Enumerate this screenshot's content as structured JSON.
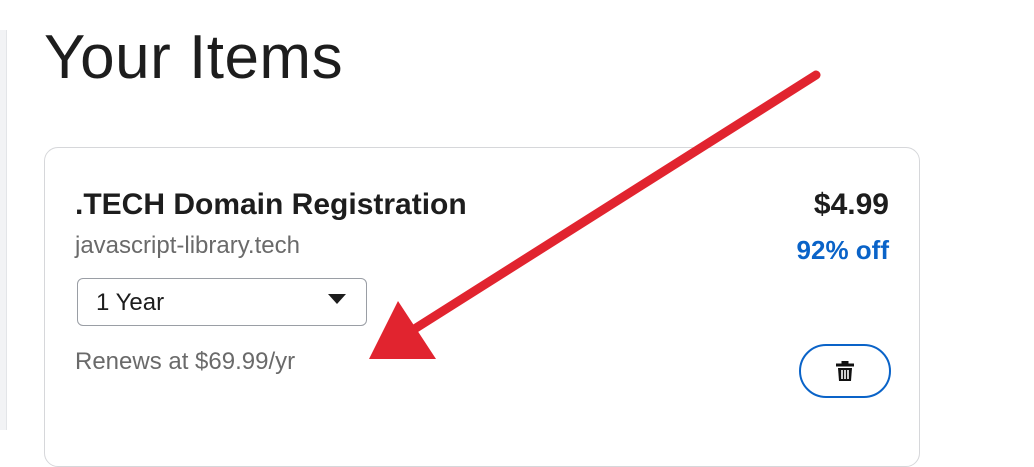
{
  "page": {
    "title": "Your Items"
  },
  "item": {
    "product_name": ".TECH Domain Registration",
    "domain": "javascript-library.tech",
    "term": "1 Year",
    "renewal": "Renews at $69.99/yr",
    "price": "$4.99",
    "discount": "92% off",
    "delete_icon": "trash-icon"
  },
  "annotation": {
    "arrow_color": "#e1242f"
  },
  "colors": {
    "accent": "#0a63c8",
    "border": "#d6d7da"
  }
}
